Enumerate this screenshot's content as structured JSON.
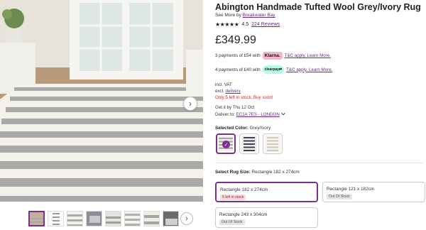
{
  "product": {
    "title": "Abington Handmade Tufted Wool Grey/Ivory Rug",
    "see_more_prefix": "See More by",
    "brand": "Breakwater Bay",
    "stars": "★★★★★",
    "rating": "4.5",
    "reviews": "224 Reviews",
    "price": "£349.99"
  },
  "payments": {
    "klarna_text": "3 payments of £54 with",
    "klarna_badge": "Klarna.",
    "klarna_terms": "T&C apply. Learn More.",
    "clearpay_text": "4 payments of £40 with",
    "clearpay_badge": "clearpay⇄",
    "clearpay_terms": "T&C apply. Learn More."
  },
  "shipping": {
    "vat": "incl. VAT",
    "excl": "excl.",
    "delivery_link": "delivery",
    "stock": "Only 5 left in stock. Buy soon!",
    "get_it": "Get it by Thu 12 Oct",
    "deliver_to": "Deliver to:",
    "postcode": "EC1A 7ES - LONDON"
  },
  "color": {
    "label": "Selected Color:",
    "value": "Grey/Ivory",
    "check": "✓"
  },
  "size": {
    "label": "Select Rug Size:",
    "value": "Rectangle 182 x 274cm",
    "options": [
      {
        "name": "Rectangle 182 x 274cm",
        "status": "5 left in stock"
      },
      {
        "name": "Rectangle 121 x 182cm",
        "status": "Out Of Stock"
      },
      {
        "name": "Rectangle 243 x 304cm",
        "status": "Out Of Stock"
      }
    ]
  },
  "gallery": {
    "next_icon": "›",
    "thumbs_next_icon": "›"
  },
  "colors": {
    "accent": "#7b2f8f",
    "link": "#6a2a82",
    "stock_red": "#d2232a"
  }
}
